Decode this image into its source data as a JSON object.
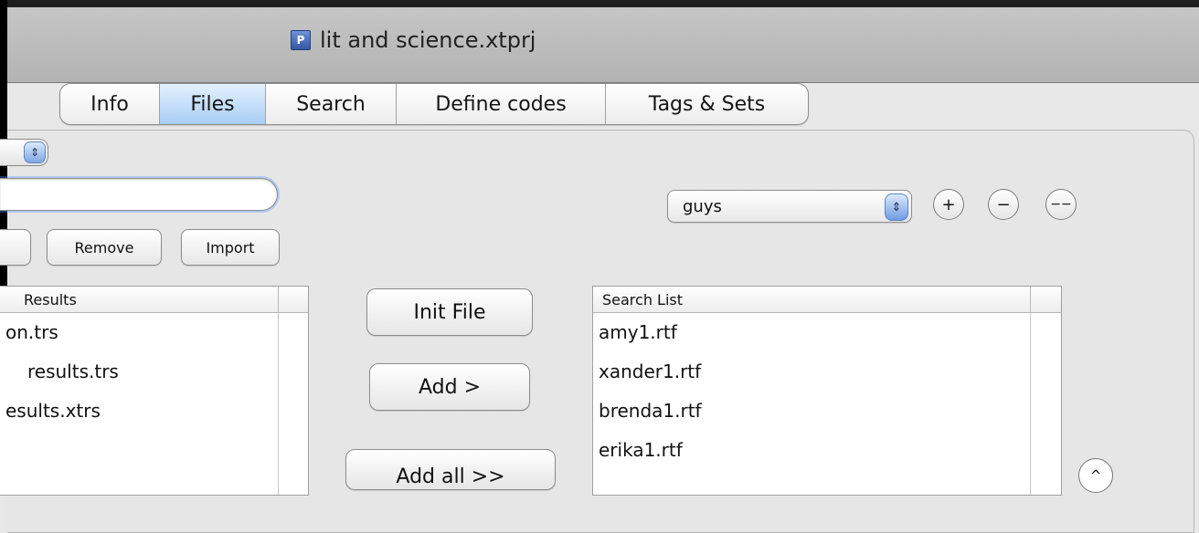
{
  "window": {
    "title": "lit and science.xtprj",
    "doc_icon_glyph": "P"
  },
  "tabs": [
    {
      "label": "Info"
    },
    {
      "label": "Files",
      "active": true
    },
    {
      "label": "Search"
    },
    {
      "label": "Define codes"
    },
    {
      "label": "Tags & Sets"
    }
  ],
  "left_controls": {
    "selector_arrow": "⇕",
    "search_value": "",
    "remove_label": "Remove",
    "import_label": "Import"
  },
  "results_list": {
    "header": "Results",
    "items": [
      "on.trs",
      " results.trs",
      "esults.xtrs"
    ]
  },
  "middle_actions": {
    "init_label": "Init File",
    "add_label": "Add >",
    "add_all_label": "Add all >>"
  },
  "right_controls": {
    "popup_value": "guys",
    "popup_arrow": "⇕",
    "plus": "+",
    "minus": "−",
    "double_minus": "−−"
  },
  "search_list": {
    "header": "Search List",
    "items": [
      "amy1.rtf",
      "xander1.rtf",
      "brenda1.rtf",
      "erika1.rtf"
    ]
  },
  "scroll_up_glyph": "^",
  "colors": {
    "active_tab": "#a8cdf4",
    "focus_ring": "#4d90fe"
  }
}
